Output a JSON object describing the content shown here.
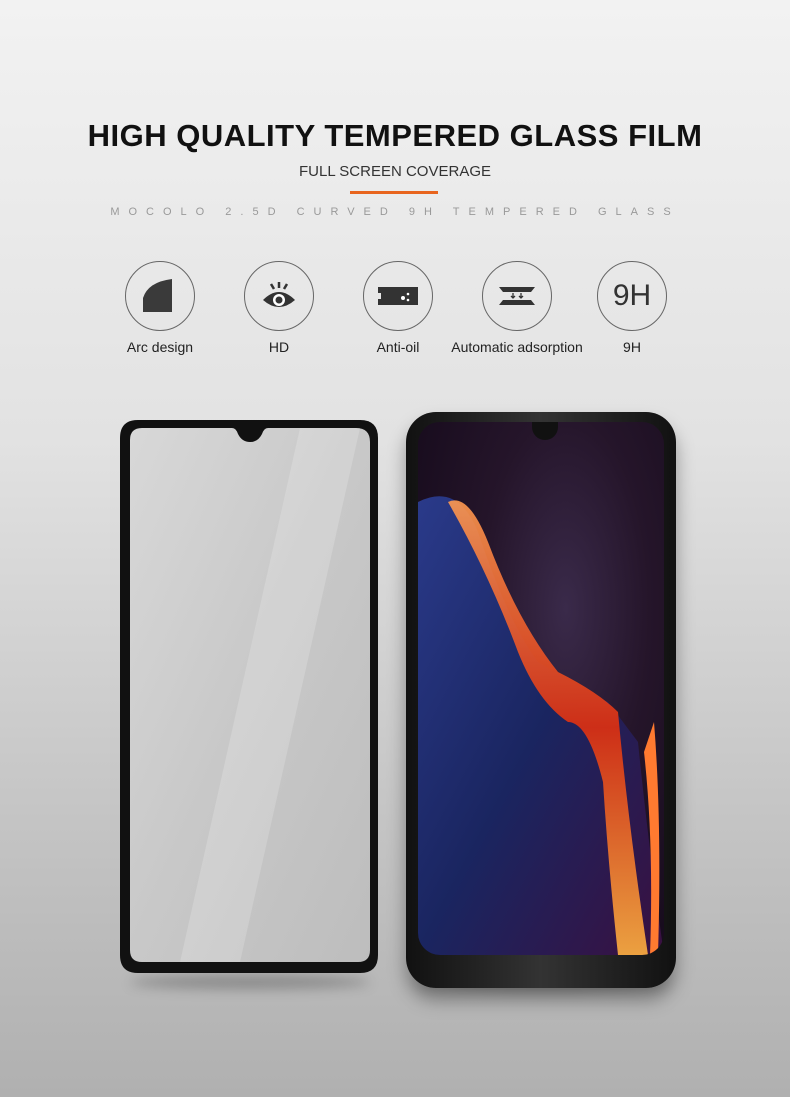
{
  "title": "HIGH QUALITY TEMPERED GLASS FILM",
  "subtitle": "FULL SCREEN COVERAGE",
  "tagline": "MOCOLO 2.5D CURVED 9H TEMPERED GLASS",
  "accent_color": "#e8651e",
  "features": [
    {
      "label": "Arc design",
      "icon": "arc-icon"
    },
    {
      "label": "HD",
      "icon": "eye-icon"
    },
    {
      "label": "Anti-oil",
      "icon": "anti-oil-icon"
    },
    {
      "label": "Automatic adsorption",
      "icon": "adsorption-icon"
    },
    {
      "label": "9H",
      "icon": "9h-icon",
      "icon_text": "9H"
    }
  ]
}
